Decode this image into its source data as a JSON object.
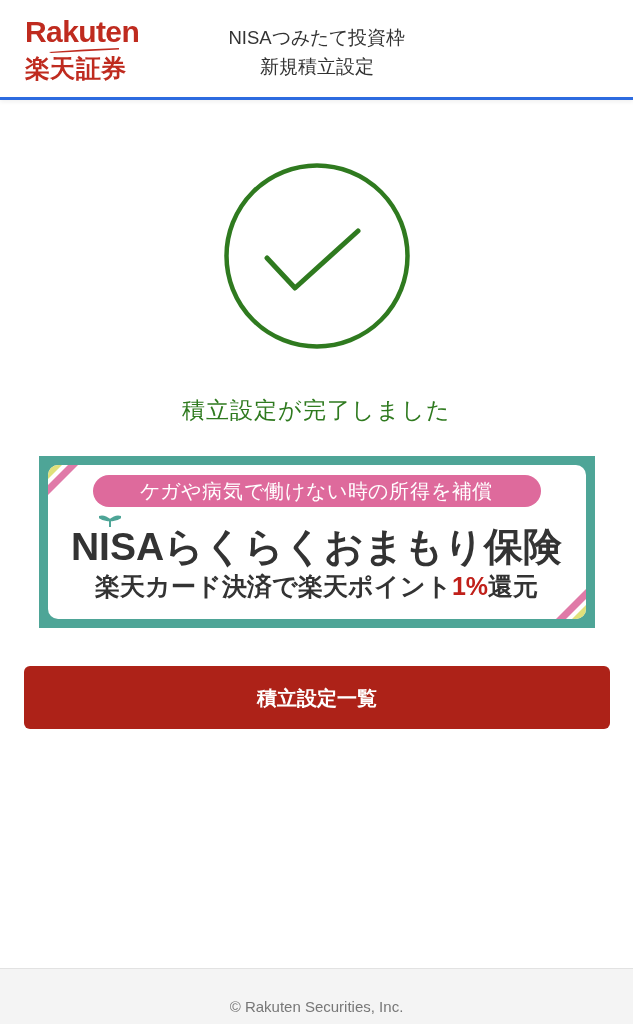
{
  "header": {
    "logo": {
      "wordmark": "Rakuten",
      "subtitle": "楽天証券"
    },
    "title_lines": [
      "NISAつみたて投資枠",
      "新規積立設定"
    ]
  },
  "result": {
    "kind": "success",
    "message": "積立設定が完了しました"
  },
  "banner": {
    "tagline": "ケガや病気で働けない時の所得を補償",
    "title": "NISAらくらくおまもり保険",
    "subtitle": "楽天カード決済で楽天ポイント**1%**還元"
  },
  "button": {
    "label": "積立設定一覧"
  },
  "footer": {
    "copyright": "© Rakuten Securities, Inc."
  }
}
